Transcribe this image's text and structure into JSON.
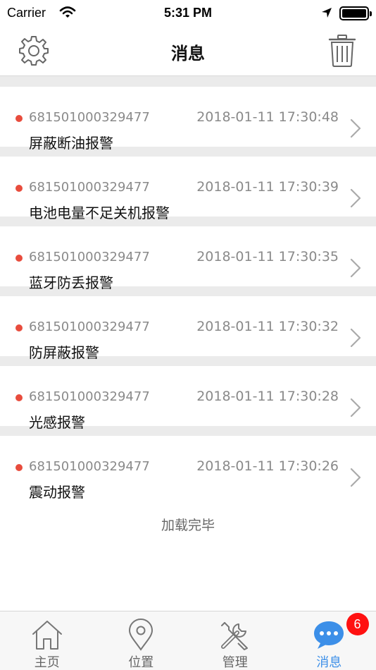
{
  "status_bar": {
    "carrier": "Carrier",
    "time": "5:31 PM"
  },
  "nav": {
    "title": "消息",
    "settings_icon": "gear-icon",
    "delete_icon": "trash-icon"
  },
  "messages": [
    {
      "device_id": "681501000329477",
      "timestamp": "2018-01-11 17:30:48",
      "alarm": "屏蔽断油报警",
      "unread": true
    },
    {
      "device_id": "681501000329477",
      "timestamp": "2018-01-11 17:30:39",
      "alarm": "电池电量不足关机报警",
      "unread": true
    },
    {
      "device_id": "681501000329477",
      "timestamp": "2018-01-11 17:30:35",
      "alarm": "蓝牙防丢报警",
      "unread": true
    },
    {
      "device_id": "681501000329477",
      "timestamp": "2018-01-11 17:30:32",
      "alarm": "防屏蔽报警",
      "unread": true
    },
    {
      "device_id": "681501000329477",
      "timestamp": "2018-01-11 17:30:28",
      "alarm": "光感报警",
      "unread": true
    },
    {
      "device_id": "681501000329477",
      "timestamp": "2018-01-11 17:30:26",
      "alarm": "震动报警",
      "unread": true
    }
  ],
  "load_complete": "加载完毕",
  "tabs": [
    {
      "label": "主页",
      "icon": "home-icon",
      "active": false
    },
    {
      "label": "位置",
      "icon": "location-pin-icon",
      "active": false
    },
    {
      "label": "管理",
      "icon": "tools-icon",
      "active": false
    },
    {
      "label": "消息",
      "icon": "chat-bubble-icon",
      "active": true,
      "badge": "6"
    }
  ],
  "colors": {
    "unread_dot": "#e84c3d",
    "active_tab": "#3c8fe8",
    "badge": "#ff1111"
  }
}
